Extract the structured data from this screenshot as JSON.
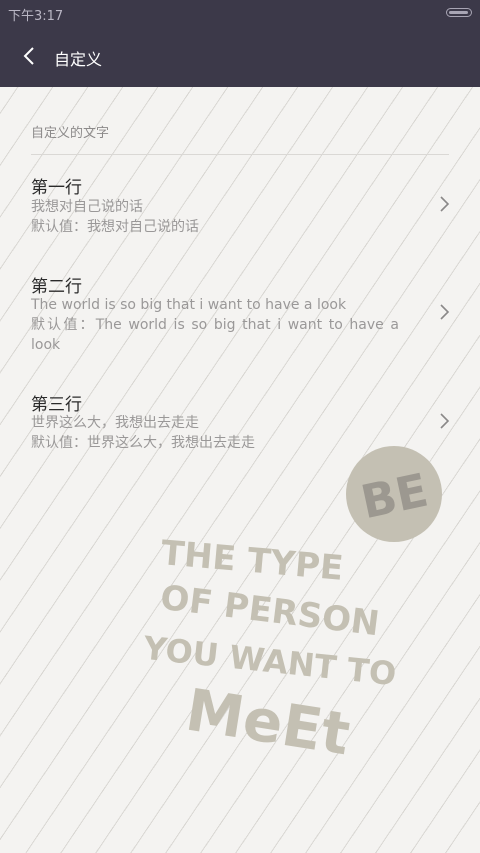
{
  "status_bar": {
    "time": "下午3:17"
  },
  "header": {
    "title": "自定义"
  },
  "section": {
    "title": "自定义的文字"
  },
  "rows": [
    {
      "title": "第一行",
      "value": "我想对自己说的话",
      "default": "默认值：我想对自己说的话"
    },
    {
      "title": "第二行",
      "value": "The world is so big that i want to have a look",
      "default": "默认值：The world is so big that i want to have a look"
    },
    {
      "title": "第三行",
      "value": "世界这么大，我想出去走走",
      "default": "默认值：世界这么大，我想出去走走"
    }
  ],
  "poster": {
    "badge": "BE",
    "line1": "THE TYPE",
    "line2": "OF PERSON",
    "line3": "YOU WANT TO",
    "line4": "MeEt"
  },
  "colors": {
    "header_bg": "#3c3949",
    "page_bg": "#f4f3f1",
    "poster_ink": "#c4c0b3",
    "badge_text": "#9c9890"
  }
}
